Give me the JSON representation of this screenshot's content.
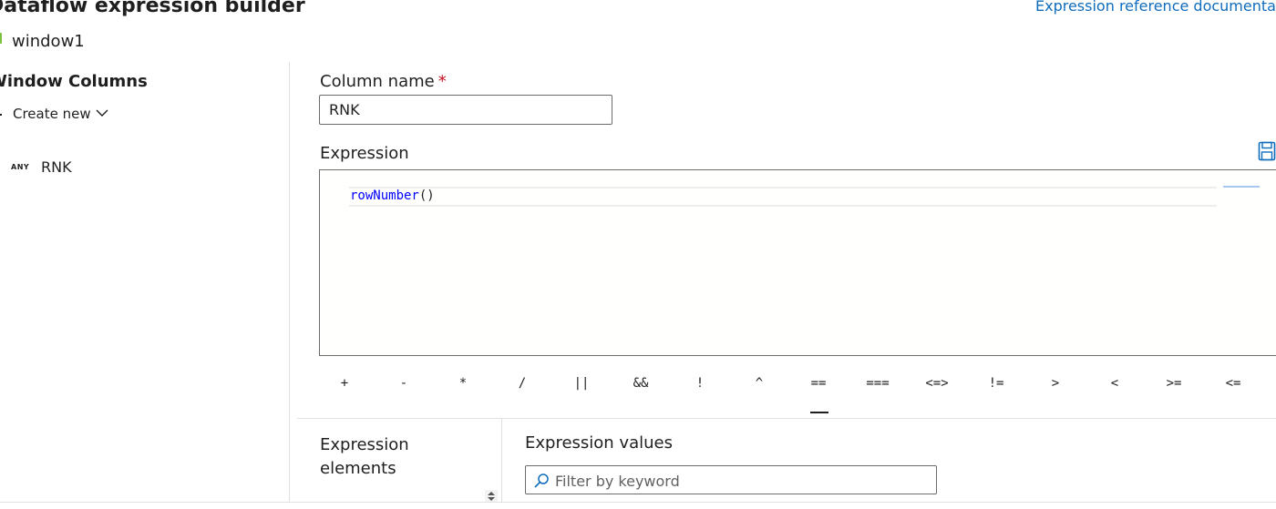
{
  "header": {
    "title": "Dataflow expression builder",
    "reference_link": "Expression reference documentation",
    "subtitle": "window1"
  },
  "left_panel": {
    "heading": "Window Columns",
    "create_new_label": "Create new",
    "columns": [
      {
        "type_badge": "ANY",
        "name": "RNK"
      }
    ]
  },
  "column_name": {
    "label": "Column name",
    "required_marker": "*",
    "value": "RNK"
  },
  "expression": {
    "label": "Expression",
    "code_function": "rowNumber",
    "code_args": "()"
  },
  "operators": [
    "+",
    "-",
    "*",
    "/",
    "||",
    "&&",
    "!",
    "^",
    "==",
    "===",
    "<=>",
    "!=",
    ">",
    "<",
    ">=",
    "<="
  ],
  "bottom": {
    "elements_heading": "Expression elements",
    "values_heading": "Expression values",
    "filter_placeholder": "Filter by keyword"
  },
  "colors": {
    "accent": "#0f6cbd",
    "code_keyword": "#0000ff",
    "required": "#c50f1f",
    "dataflow_icon": "#7cc242"
  },
  "icons": [
    "plus-icon",
    "chevron-down-icon",
    "save-icon",
    "search-icon",
    "sort-icon",
    "dataflow-icon"
  ]
}
